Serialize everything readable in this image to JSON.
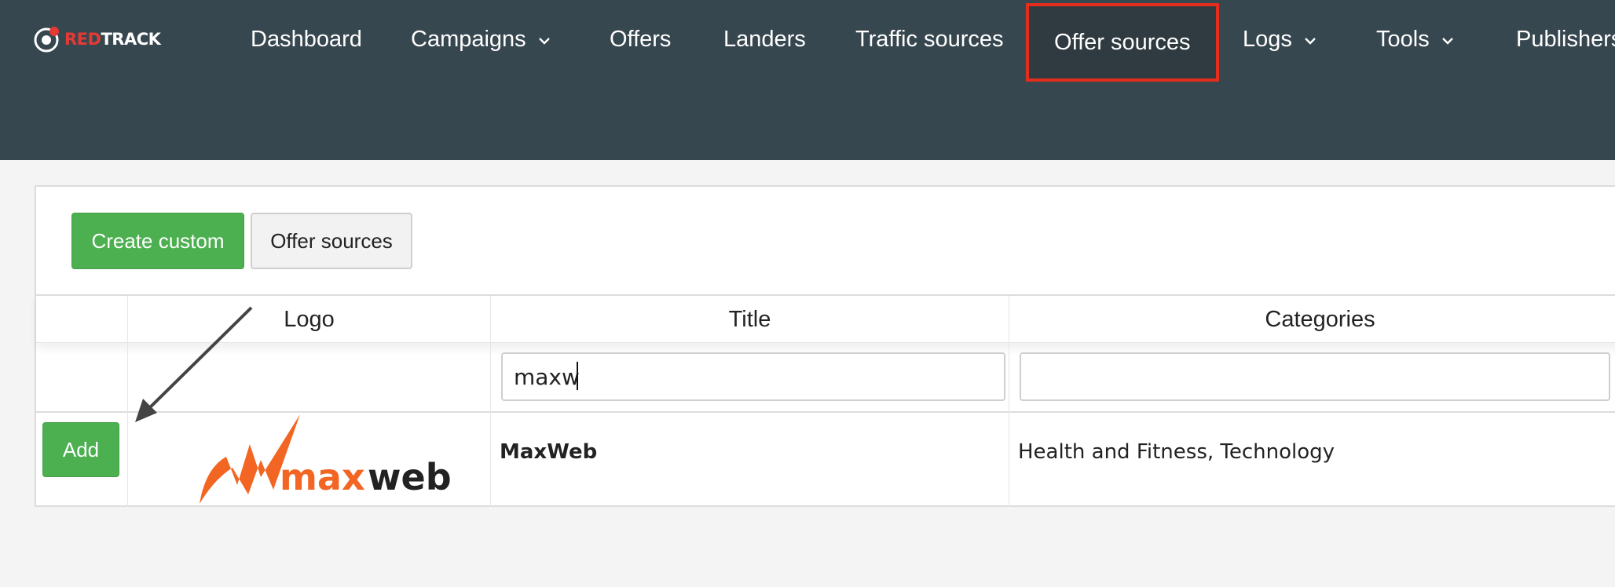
{
  "brand": {
    "part1": "RED",
    "part2": "TRACK",
    "accent_color": "#e53935",
    "nav_bg_color": "#37474f"
  },
  "nav": {
    "items": [
      {
        "label": "Dashboard"
      },
      {
        "label": "Campaigns",
        "icon": "chevron-down-icon"
      },
      {
        "label": "Offers"
      },
      {
        "label": "Landers"
      },
      {
        "label": "Traffic sources"
      },
      {
        "label": "Offer sources",
        "active": true,
        "highlight_color": "#e52d1e"
      },
      {
        "label": "Logs",
        "icon": "chevron-down-icon"
      },
      {
        "label": "Tools",
        "icon": "chevron-down-icon"
      },
      {
        "label": "Publishers"
      }
    ]
  },
  "toolbar": {
    "create_label": "Create custom",
    "offer_sources_label": "Offer sources",
    "button_color": "#4caf50"
  },
  "table": {
    "headers": {
      "logo": "Logo",
      "title": "Title",
      "categories": "Categories"
    },
    "filters": {
      "title_value": "maxw",
      "categories_value": ""
    },
    "rows": [
      {
        "action_label": "Add",
        "logo_text_part1": "max",
        "logo_text_part2": "web",
        "logo_color": "#f26522",
        "title": "MaxWeb",
        "categories": "Health and Fitness, Technology"
      }
    ]
  }
}
